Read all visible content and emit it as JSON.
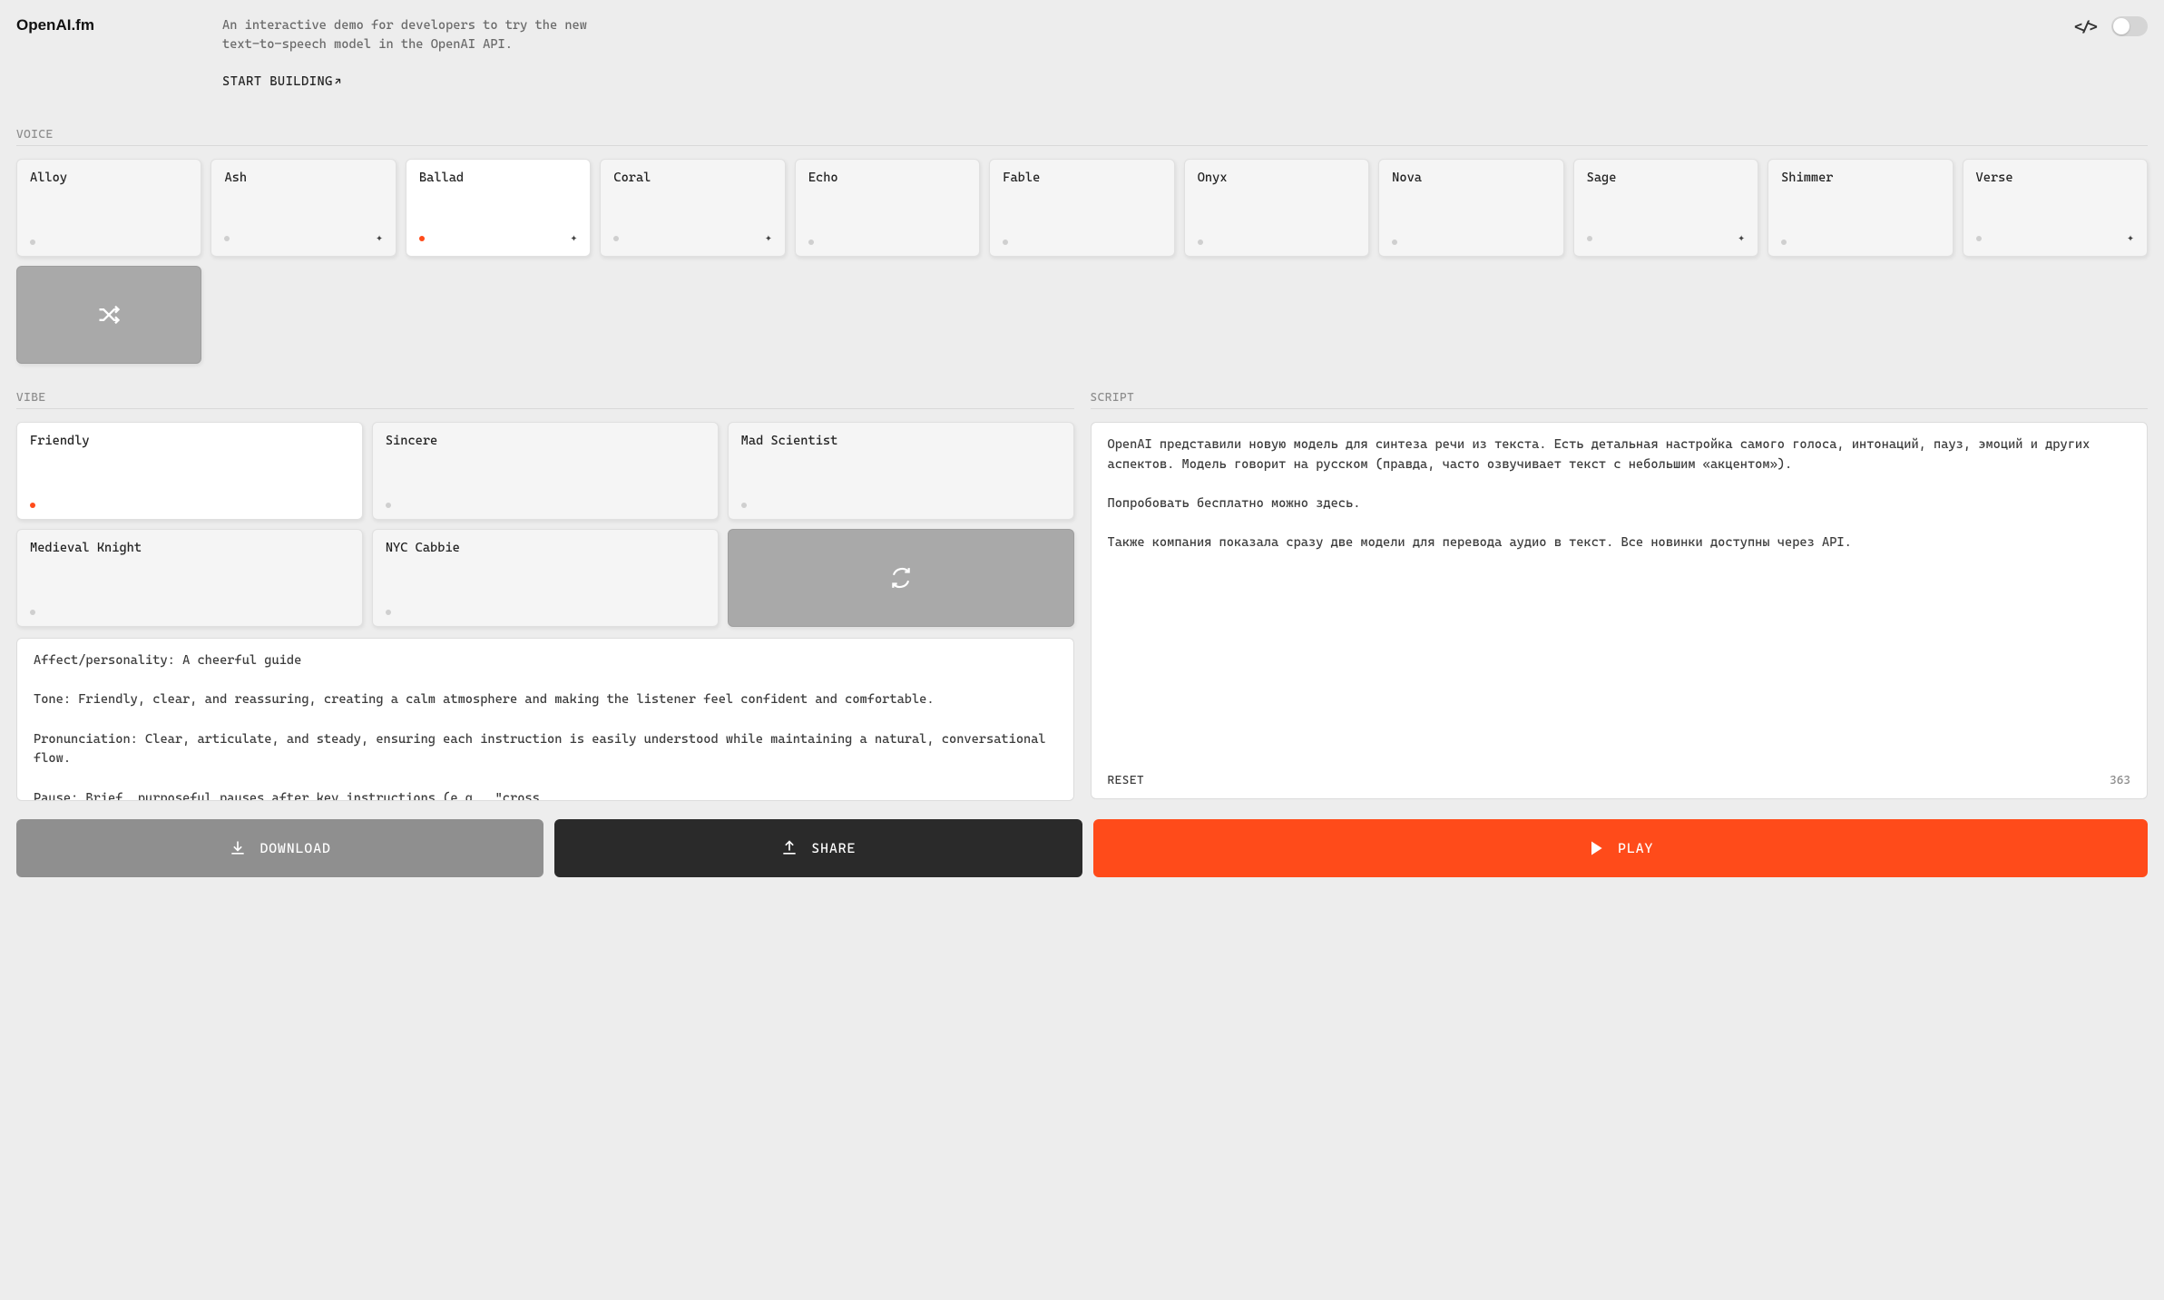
{
  "header": {
    "logo": "OpenAI.fm",
    "description": "An interactive demo for developers to try the new text-to-speech model in the OpenAI API.",
    "start_building": "START BUILDING"
  },
  "sections": {
    "voice": "VOICE",
    "vibe": "VIBE",
    "script": "SCRIPT"
  },
  "voices": [
    {
      "name": "Alloy",
      "sparkle": false,
      "selected": false
    },
    {
      "name": "Ash",
      "sparkle": true,
      "selected": false
    },
    {
      "name": "Ballad",
      "sparkle": true,
      "selected": true
    },
    {
      "name": "Coral",
      "sparkle": true,
      "selected": false
    },
    {
      "name": "Echo",
      "sparkle": false,
      "selected": false
    },
    {
      "name": "Fable",
      "sparkle": false,
      "selected": false
    },
    {
      "name": "Onyx",
      "sparkle": false,
      "selected": false
    },
    {
      "name": "Nova",
      "sparkle": false,
      "selected": false
    },
    {
      "name": "Sage",
      "sparkle": true,
      "selected": false
    },
    {
      "name": "Shimmer",
      "sparkle": false,
      "selected": false
    },
    {
      "name": "Verse",
      "sparkle": true,
      "selected": false
    }
  ],
  "vibes": {
    "items": [
      {
        "name": "Friendly",
        "selected": true
      },
      {
        "name": "Sincere",
        "selected": false
      },
      {
        "name": "Mad Scientist",
        "selected": false
      },
      {
        "name": "Medieval Knight",
        "selected": false
      },
      {
        "name": "NYC Cabbie",
        "selected": false
      }
    ],
    "details": "Affect/personality: A cheerful guide\n\nTone: Friendly, clear, and reassuring, creating a calm atmosphere and making the listener feel confident and comfortable.\n\nPronunciation: Clear, articulate, and steady, ensuring each instruction is easily understood while maintaining a natural, conversational flow.\n\nPause: Brief, purposeful pauses after key instructions (e.g., \"cross"
  },
  "script": {
    "text": "OpenAI представили новую модель для синтеза речи из текста. Есть детальная настройка самого голоса, интонаций, пауз, эмоций и других аспектов. Модель говорит на русском (правда, часто озвучивает текст с небольшим «акцентом»).\n\nПопробовать бесплатно можно здесь.\n\nТакже компания показала сразу две модели для перевода аудио в текст. Все новинки доступны через API.",
    "reset": "RESET",
    "char_count": "363"
  },
  "actions": {
    "download": "DOWNLOAD",
    "share": "SHARE",
    "play": "PLAY"
  }
}
